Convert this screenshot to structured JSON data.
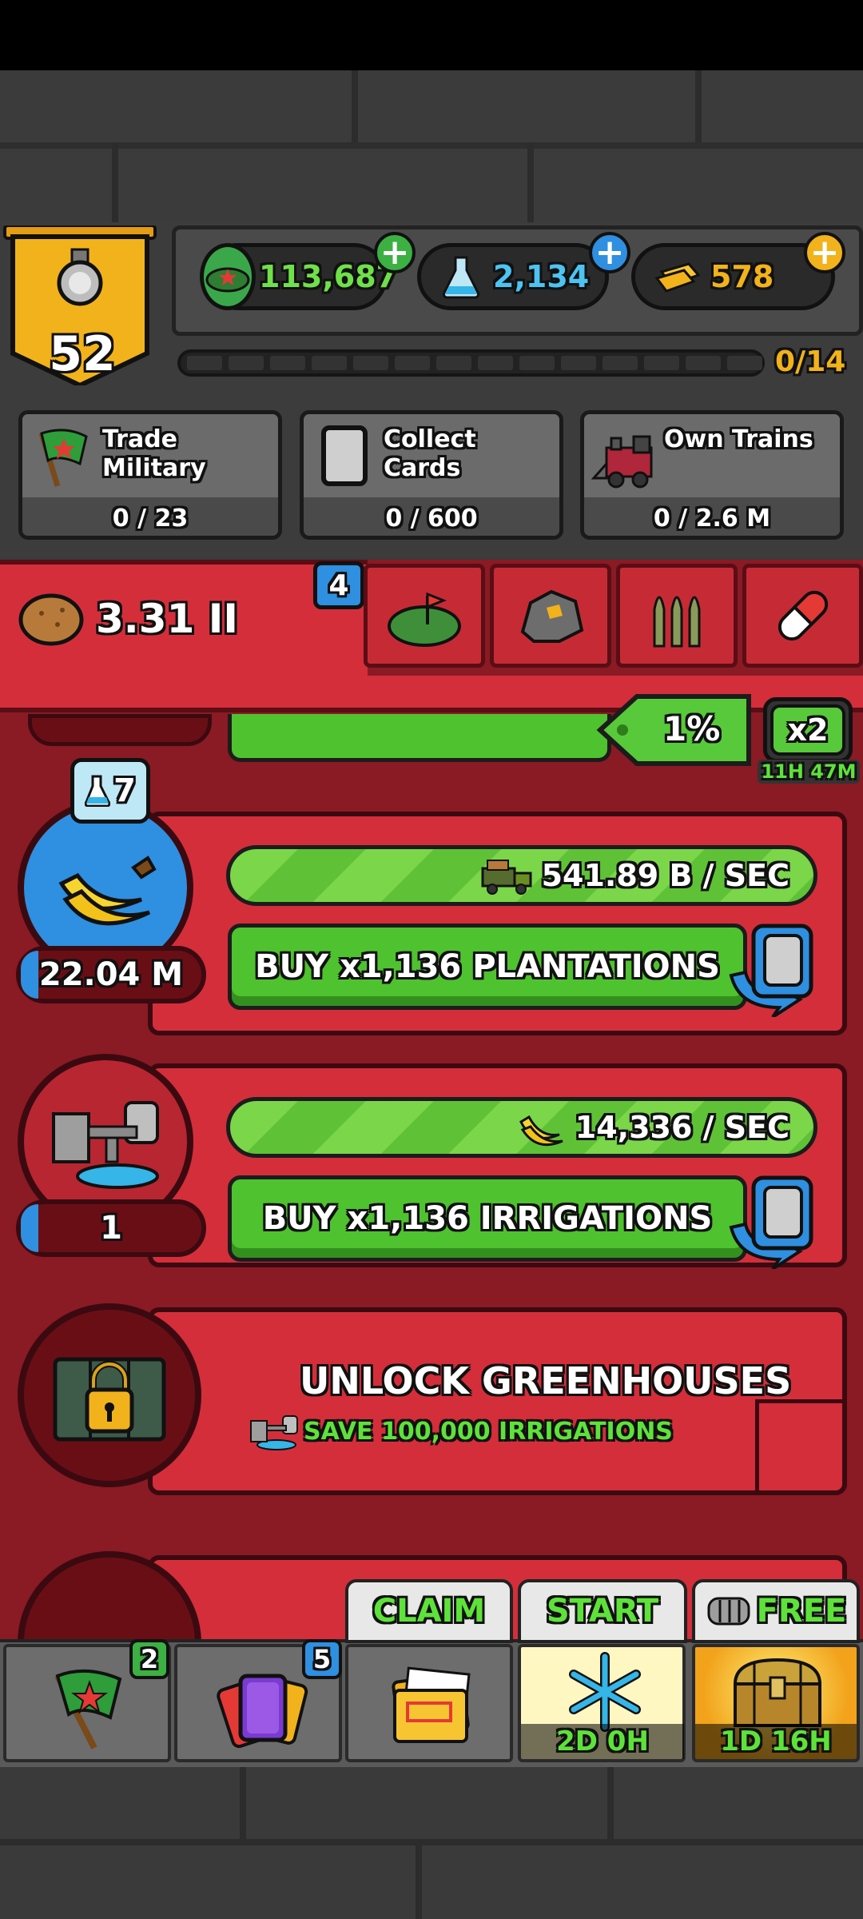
{
  "player": {
    "level": "52"
  },
  "currencies": {
    "military": "113,687",
    "science": "2,134",
    "gold": "578"
  },
  "progress": {
    "label": "0/14",
    "fraction": 0.0
  },
  "tasks": [
    {
      "label": "Trade Military",
      "line1": "Trade",
      "line2": "Military",
      "progress": "0 / 23"
    },
    {
      "label": "Collect Cards",
      "progress": "0 / 600"
    },
    {
      "label": "Own Trains",
      "progress": "0 / 2.6 M"
    }
  ],
  "resource": {
    "amount": "3.31 II",
    "badge": "4",
    "tabs": [
      "farm-field-icon",
      "ore-rock-icon",
      "ammo-icon",
      "pill-icon"
    ]
  },
  "boost": {
    "percent": "1%",
    "multiplier": "x2",
    "timer": "11H 47M"
  },
  "plantations": {
    "science_badge": "7",
    "count": "22.04 M",
    "rate": "541.89 B / SEC",
    "buy_label": "BUY x1,136 PLANTATIONS"
  },
  "irrigations": {
    "count": "1",
    "rate": "14,336 / SEC",
    "buy_label": "BUY x1,136 IRRIGATIONS"
  },
  "greenhouses": {
    "title": "UNLOCK GREENHOUSES",
    "requirement": "SAVE 100,000 IRRIGATIONS"
  },
  "bottom_nav": {
    "military_badge": "2",
    "cards_badge": "5",
    "claim_label": "CLAIM",
    "start_label": "START",
    "start_timer": "2D 0H",
    "free_label": "FREE",
    "free_timer": "1D 16H"
  },
  "colors": {
    "accent_red": "#d42e3b",
    "dark_red": "#8a1a24",
    "green": "#4fc22f",
    "gold": "#f2b21b",
    "blue": "#2f8fe0"
  }
}
